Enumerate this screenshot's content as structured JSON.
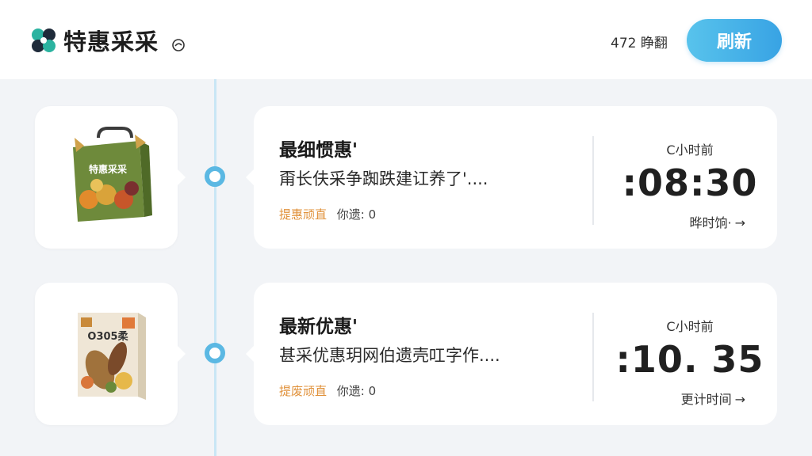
{
  "header": {
    "brand": "特惠采采",
    "count_label": "472 睁翻",
    "refresh_label": "刷新"
  },
  "deals": [
    {
      "title": "最细惯惠'",
      "description": "甭长伕采争踟跌建讧养了'....",
      "tag": "提惠顽直",
      "count": "你遗: 0",
      "time_ago": "C小时前",
      "time_value": ":08:30",
      "time_link": "晔时饷·",
      "product_box_text": "特惠采采"
    },
    {
      "title": "最新优惠'",
      "description": "甚采优惠玥网伯遗壳叿字作....",
      "tag": "提废顽直",
      "count": "你遗: 0",
      "time_ago": "C小时前",
      "time_value": ":10. 35",
      "time_link": "更计时间",
      "product_box_text": "O305柔"
    }
  ],
  "colors": {
    "accent": "#38a3e4",
    "tag": "#e0913a",
    "timeline": "#5bb8e3"
  },
  "icons": {
    "logo": "clover-logo-icon",
    "arrow": "arrow-right-icon"
  }
}
